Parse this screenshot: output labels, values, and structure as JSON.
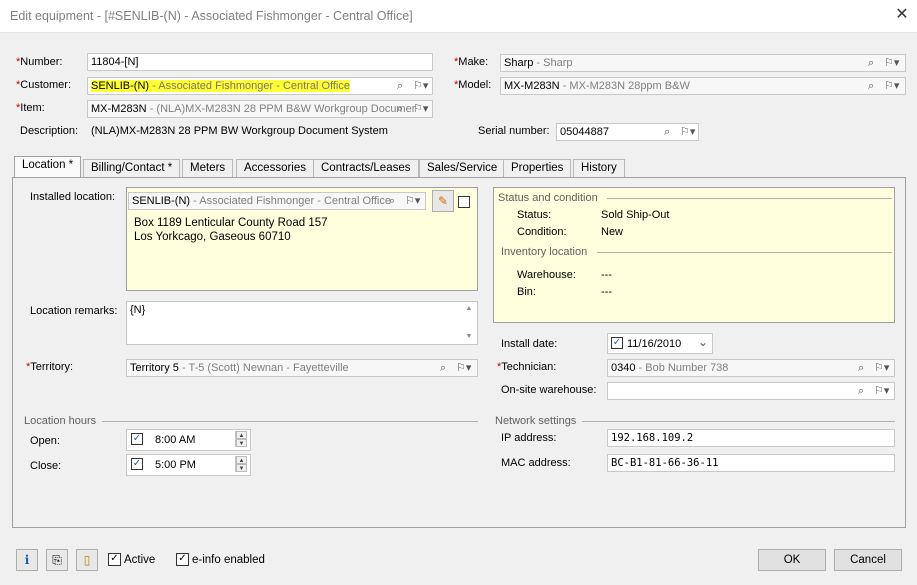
{
  "window": {
    "title": "Edit equipment - [#SENLIB-(N) - Associated Fishmonger - Central Office]",
    "close_glyph": "✕"
  },
  "header": {
    "number_label": "Number:",
    "number_value": "11804-[N]",
    "customer_label": "Customer:",
    "customer_code": "SENLIB-(N)",
    "customer_desc": " - Associated Fishmonger - Central Office",
    "item_label": "Item:",
    "item_code": "MX-M283N",
    "item_desc": " - (NLA)MX-M283N 28 PPM B&W Workgroup Documer",
    "description_label": "Description:",
    "description_value": "(NLA)MX-M283N 28 PPM BW Workgroup Document System",
    "make_label": "Make:",
    "make_code": "Sharp",
    "make_desc": " - Sharp",
    "model_label": "Model:",
    "model_code": "MX-M283N",
    "model_desc": " - MX-M283N 28ppm B&W",
    "serial_label": "Serial number:",
    "serial_value": "05044887",
    "required_mark": "*"
  },
  "icons": {
    "search": "⌕",
    "flag_dropdown": "⚐▾",
    "pencil": "✎",
    "info": "i",
    "paperclip": "⎘",
    "document": "▯",
    "check": "✓",
    "spin_up": "▲",
    "spin_down": "▼",
    "dropdown": "⌄"
  },
  "tabs": [
    {
      "label": "Location *"
    },
    {
      "label": "Billing/Contact *"
    },
    {
      "label": "Meters"
    },
    {
      "label": "Accessories"
    },
    {
      "label": "Contracts/Leases"
    },
    {
      "label": "Sales/Service"
    },
    {
      "label": "Properties"
    },
    {
      "label": "History"
    }
  ],
  "location": {
    "installed_label": "Installed location:",
    "installed_code": "SENLIB-(N)",
    "installed_desc": " - Associated Fishmonger - Central Office",
    "address_line1": "Box 1189 Lenticular County Road 157",
    "address_line2": "Los Yorkcago, Gaseous 60710",
    "remarks_label": "Location remarks:",
    "remarks_value": "{N}",
    "territory_label": "Territory:",
    "territory_code": "Territory 5",
    "territory_desc": " - T-5 (Scott) Newnan - Fayetteville",
    "hours_label": "Location hours",
    "open_label": "Open:",
    "open_value": "8:00 AM",
    "close_label": "Close:",
    "close_value": "5:00 PM"
  },
  "status": {
    "section_label": "Status and condition",
    "status_label": "Status:",
    "status_value": "Sold Ship-Out",
    "condition_label": "Condition:",
    "condition_value": "New",
    "inventory_label": "Inventory location",
    "warehouse_label": "Warehouse:",
    "warehouse_value": "---",
    "bin_label": "Bin:",
    "bin_value": "---"
  },
  "install": {
    "date_label": "Install date:",
    "date_value": "11/16/2010",
    "technician_label": "Technician:",
    "technician_code": "0340",
    "technician_desc": " - Bob Number 738",
    "onsite_label": "On-site warehouse:",
    "onsite_value": ""
  },
  "network": {
    "section_label": "Network settings",
    "ip_label": "IP address:",
    "ip_value": "192.168.109.2",
    "mac_label": "MAC address:",
    "mac_value": "BC-B1-81-66-36-11"
  },
  "footer": {
    "active_label": "Active",
    "einfo_label": "e-info enabled",
    "ok_label": "OK",
    "cancel_label": "Cancel"
  }
}
